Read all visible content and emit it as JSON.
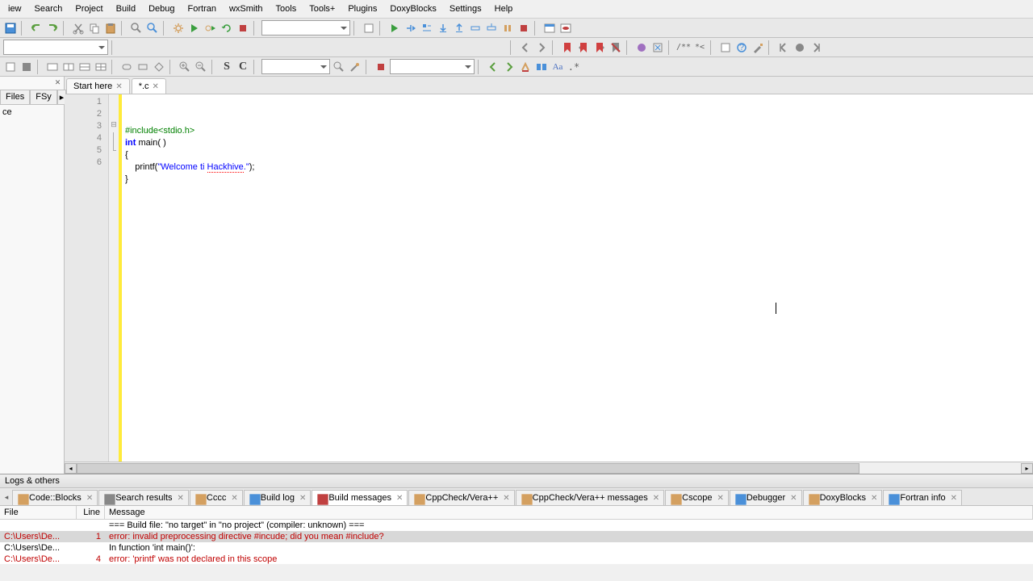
{
  "menu": {
    "items": [
      "iew",
      "Search",
      "Project",
      "Build",
      "Debug",
      "Fortran",
      "wxSmith",
      "Tools",
      "Tools+",
      "Plugins",
      "DoxyBlocks",
      "Settings",
      "Help"
    ]
  },
  "sidebar": {
    "tabs": [
      "Files",
      "FSy"
    ],
    "content": "ce"
  },
  "editor_tabs": [
    {
      "label": "Start here",
      "active": false
    },
    {
      "label": "*.c",
      "active": true
    }
  ],
  "code": {
    "lines": [
      {
        "n": "1",
        "html": "<span class='kw-pre'>#include&lt;stdio.h&gt;</span>"
      },
      {
        "n": "2",
        "html": "<span class='kw-type'>int</span> main( )"
      },
      {
        "n": "3",
        "html": "{"
      },
      {
        "n": "4",
        "html": "    printf(<span class='kw-str'>\"Welcome ti </span><span class='kw-spell'>Hackhive</span><span class='kw-str'>.\"</span>);"
      },
      {
        "n": "5",
        "html": "}"
      },
      {
        "n": "6",
        "html": ""
      }
    ]
  },
  "logs": {
    "title": "Logs & others",
    "tabs": [
      "Code::Blocks",
      "Search results",
      "Cccc",
      "Build log",
      "Build messages",
      "CppCheck/Vera++",
      "CppCheck/Vera++ messages",
      "Cscope",
      "Debugger",
      "DoxyBlocks",
      "Fortran info"
    ],
    "active_tab": 4,
    "headers": {
      "file": "File",
      "line": "Line",
      "msg": "Message"
    },
    "rows": [
      {
        "file": "",
        "line": "",
        "msg": "=== Build file: \"no target\" in \"no project\" (compiler: unknown) ===",
        "cls": ""
      },
      {
        "file": "C:\\Users\\De...",
        "line": "1",
        "msg": "error: invalid preprocessing directive #incude; did you mean #include?",
        "cls": "error selected"
      },
      {
        "file": "C:\\Users\\De...",
        "line": "",
        "msg": "In function 'int main()':",
        "cls": ""
      },
      {
        "file": "C:\\Users\\De...",
        "line": "4",
        "msg": "error: 'printf' was not declared in this scope",
        "cls": "error"
      }
    ]
  }
}
